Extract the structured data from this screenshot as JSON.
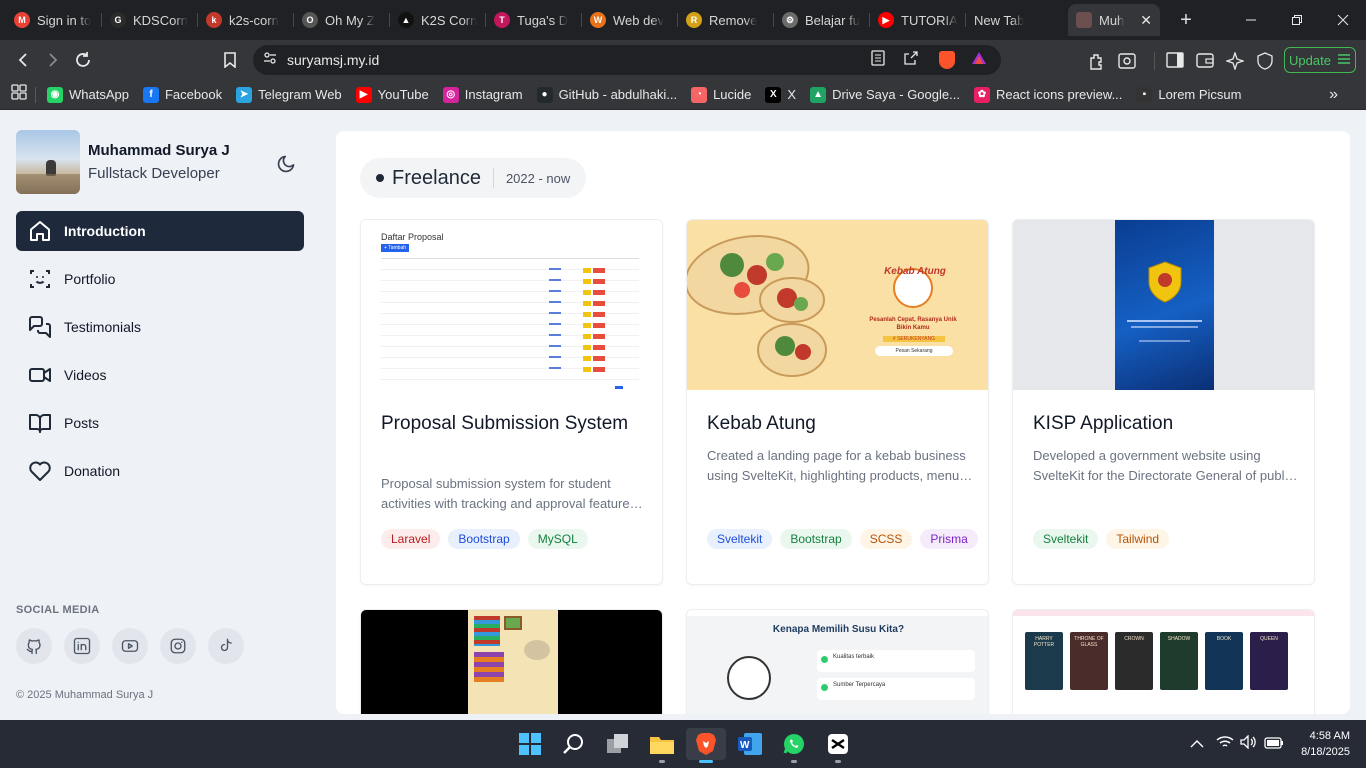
{
  "browser": {
    "tabs": [
      {
        "title": "Sign in to",
        "color": "#e94235",
        "glyph": "M"
      },
      {
        "title": "KDSCorn",
        "color": "#2b2b2b",
        "glyph": "G"
      },
      {
        "title": "k2s-corn",
        "color": "#c0392b",
        "glyph": "k"
      },
      {
        "title": "Oh My Z",
        "color": "#555555",
        "glyph": "O"
      },
      {
        "title": "K2S Corn",
        "color": "#111111",
        "glyph": "▲"
      },
      {
        "title": "Tuga's D",
        "color": "#c2185b",
        "glyph": "T"
      },
      {
        "title": "Web dev",
        "color": "#e8711a",
        "glyph": "W"
      },
      {
        "title": "Remove",
        "color": "#d4a017",
        "glyph": "R"
      },
      {
        "title": "Belajar fu",
        "color": "#6b6b6b",
        "glyph": "⚙"
      },
      {
        "title": "TUTORIA",
        "color": "#ff0000",
        "glyph": "▶"
      },
      {
        "title": "New Tab",
        "color": "",
        "glyph": ""
      }
    ],
    "active_tab": {
      "title": "Muh",
      "color": "#6b4f4f"
    },
    "new_tab_label": "+",
    "url": "suryamsj.my.id",
    "update_label": "Update",
    "bookmarks": [
      {
        "label": "WhatsApp",
        "color": "#25d366",
        "glyph": "◉"
      },
      {
        "label": "Facebook",
        "color": "#1877f2",
        "glyph": "f"
      },
      {
        "label": "Telegram Web",
        "color": "#2aa3de",
        "glyph": "➤"
      },
      {
        "label": "YouTube",
        "color": "#ff0000",
        "glyph": "▶"
      },
      {
        "label": "Instagram",
        "color": "#d6249f",
        "glyph": "◎"
      },
      {
        "label": "GitHub - abdulhaki...",
        "color": "#24292e",
        "glyph": "●"
      },
      {
        "label": "Lucide",
        "color": "#f56565",
        "glyph": "◔"
      },
      {
        "label": "X",
        "color": "#000000",
        "glyph": "X"
      },
      {
        "label": "Drive Saya - Google...",
        "color": "#1fa463",
        "glyph": "▲"
      },
      {
        "label": "React icons preview...",
        "color": "#e91e63",
        "glyph": "✿"
      },
      {
        "label": "Lorem Picsum",
        "color": "#333333",
        "glyph": "▪"
      }
    ]
  },
  "profile": {
    "name": "Muhammad Surya J",
    "role": "Fullstack Developer"
  },
  "nav": [
    {
      "label": "Introduction",
      "icon": "home-icon",
      "active": true
    },
    {
      "label": "Portfolio",
      "icon": "scan-face-icon"
    },
    {
      "label": "Testimonials",
      "icon": "message-square-icon"
    },
    {
      "label": "Videos",
      "icon": "video-icon"
    },
    {
      "label": "Posts",
      "icon": "book-open-icon"
    },
    {
      "label": "Donation",
      "icon": "heart-icon"
    }
  ],
  "social": {
    "title": "SOCIAL MEDIA",
    "icons": [
      "github-icon",
      "linkedin-icon",
      "youtube-icon",
      "instagram-icon",
      "tiktok-icon"
    ]
  },
  "copyright": "© 2025 Muhammad Surya J",
  "section": {
    "title": "Freelance",
    "years": "2022 - now"
  },
  "projects": [
    {
      "title": "Proposal Submission System",
      "description": "Proposal submission system for student activities with tracking and approval features for campus organizations.",
      "tags": [
        {
          "label": "Laravel",
          "bg": "#fdecec",
          "color": "#b91c1c"
        },
        {
          "label": "Bootstrap",
          "bg": "#e8f0fe",
          "color": "#1d4ed8"
        },
        {
          "label": "MySQL",
          "bg": "#e9f7ef",
          "color": "#15803d"
        }
      ],
      "screenshot_text": {
        "heading": "Daftar Proposal",
        "button": "+ Tambah"
      }
    },
    {
      "title": "Kebab Atung",
      "description": "Created a landing page for a kebab business using SvelteKit, highlighting products, menu and ordering information.",
      "tags": [
        {
          "label": "Sveltekit",
          "bg": "#e8f0fe",
          "color": "#1d4ed8"
        },
        {
          "label": "Bootstrap",
          "bg": "#e9f7ef",
          "color": "#15803d"
        },
        {
          "label": "SCSS",
          "bg": "#fff5e6",
          "color": "#b45309"
        },
        {
          "label": "Prisma",
          "bg": "#f5ebfa",
          "color": "#7e22ce"
        }
      ],
      "screenshot_text": {
        "brand": "Kebab Atung",
        "tagline": "Pesanlah Cepat, Rasanya Unik Bikin Kamu",
        "hashtag": "# SERUKENYANG",
        "button": "Pesan Sekarang"
      }
    },
    {
      "title": "KISP Application",
      "description": "Developed a government website using SvelteKit for the Directorate General of public service information.",
      "tags": [
        {
          "label": "Sveltekit",
          "bg": "#e9f7ef",
          "color": "#15803d"
        },
        {
          "label": "Tailwind",
          "bg": "#fff5e6",
          "color": "#b45309"
        }
      ]
    }
  ],
  "second_row": {
    "milk_heading": "Kenapa Memilih Susu Kita?",
    "milk_items": [
      "Kualitas terbaik",
      "Sumber Terpercaya"
    ],
    "book_titles": [
      "HARRY POTTER",
      "THRONE OF GLASS",
      "CROWN",
      "SHADOW",
      "BOOK",
      "QUEEN"
    ]
  },
  "taskbar": {
    "time": "4:58 AM",
    "date": "8/18/2025",
    "apps": [
      "windows-start-icon",
      "search-icon",
      "task-view-icon",
      "file-explorer-icon",
      "brave-icon",
      "word-icon",
      "whatsapp-icon",
      "capcut-icon"
    ]
  }
}
